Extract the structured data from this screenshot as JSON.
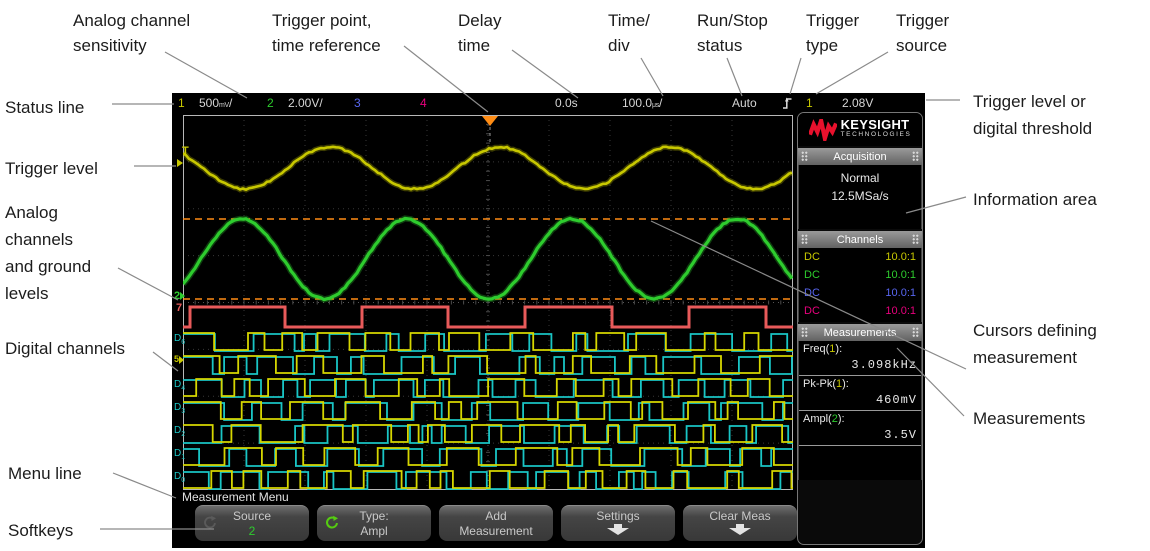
{
  "annotations": {
    "top": [
      {
        "text": "Analog channel\nsensitivity"
      },
      {
        "text": "Trigger point,\ntime reference"
      },
      {
        "text": "Delay\ntime"
      },
      {
        "text": "Time/\ndiv"
      },
      {
        "text": "Run/Stop\nstatus"
      },
      {
        "text": "Trigger\ntype"
      },
      {
        "text": "Trigger\nsource"
      }
    ],
    "left": [
      {
        "text": "Status line"
      },
      {
        "text": "Trigger level"
      },
      {
        "text": "Analog\nchannels\nand ground\nlevels"
      },
      {
        "text": "Digital channels"
      },
      {
        "text": "Menu line"
      },
      {
        "text": "Softkeys"
      }
    ],
    "right": [
      {
        "text": "Trigger level or\ndigital threshold"
      },
      {
        "text": "Information area"
      },
      {
        "text": "Cursors defining\nmeasurement"
      },
      {
        "text": "Measurements"
      }
    ]
  },
  "scope": {
    "status_bar": {
      "ch1": {
        "num": "1",
        "value": "500",
        "unit": "mV",
        "suffix": "/"
      },
      "ch2": {
        "num": "2",
        "value": "2.00V/"
      },
      "ch3": {
        "num": "3"
      },
      "ch4": {
        "num": "4"
      },
      "delay_time": "0.0s",
      "time_div": {
        "value": "100.0",
        "unit": "μs",
        "suffix": "/"
      },
      "run_stop": "Auto",
      "trigger_source": "1",
      "trigger_level": "2.08V"
    },
    "markers": {
      "trigger": "T",
      "ch2_ground": "2",
      "d7": "7",
      "d5_selected": "5"
    },
    "digital_labels": [
      {
        "ch": "D",
        "n": "6"
      },
      {
        "ch": "D",
        "n": "4"
      },
      {
        "ch": "D",
        "n": "3"
      },
      {
        "ch": "D",
        "n": "2"
      },
      {
        "ch": "D",
        "n": "1"
      },
      {
        "ch": "D",
        "n": "0"
      }
    ],
    "sidebar": {
      "brand": {
        "name": "KEYSIGHT",
        "sub": "TECHNOLOGIES"
      },
      "acquisition": {
        "title": "Acquisition",
        "mode": "Normal",
        "sample_rate": "12.5MSa/s"
      },
      "channels": {
        "title": "Channels",
        "rows": [
          {
            "coupling": "DC",
            "probe": "10.0:1",
            "color": "#c8c800"
          },
          {
            "coupling": "DC",
            "probe": "10.0:1",
            "color": "#2ecc2e"
          },
          {
            "coupling": "DC",
            "probe": "10.0:1",
            "color": "#5866f0"
          },
          {
            "coupling": "DC",
            "probe": "10.0:1",
            "color": "#e8007d"
          }
        ]
      },
      "measurements": {
        "title": "Measurements",
        "items": [
          {
            "name_prefix": "Freq(",
            "source": "1",
            "name_suffix": "):",
            "source_color": "#c8c800",
            "value": "3.098kHz"
          },
          {
            "name_prefix": "Pk-Pk(",
            "source": "1",
            "name_suffix": "):",
            "source_color": "#c8c800",
            "value": "460mV"
          },
          {
            "name_prefix": "Ampl(",
            "source": "2",
            "name_suffix": "):",
            "source_color": "#2ecc2e",
            "value": "3.5V"
          }
        ]
      }
    },
    "menu_line": "Measurement Menu",
    "softkeys": [
      {
        "line1": "Source",
        "line2": "2",
        "icon": "circular-arrow-dim"
      },
      {
        "line1": "Type:",
        "line2": "Ampl",
        "icon": "circular-arrow-green"
      },
      {
        "line1": "Add",
        "line2": "Measurement"
      },
      {
        "line1": "Settings",
        "icon": "down-arrow"
      },
      {
        "line1": "Clear Meas",
        "icon": "down-arrow"
      }
    ]
  },
  "colors": {
    "channel1_yellow": "#c8c800",
    "channel2_green": "#2ecc2e",
    "channel3_blue": "#5866f0",
    "channel4_magenta": "#e8007d",
    "cursor_orange": "#ff8c14",
    "digital_cyan": "#19c5c5",
    "digital_yellow": "#d6d600",
    "d7_red": "#e85a5a",
    "brand_red": "#e8112d"
  }
}
